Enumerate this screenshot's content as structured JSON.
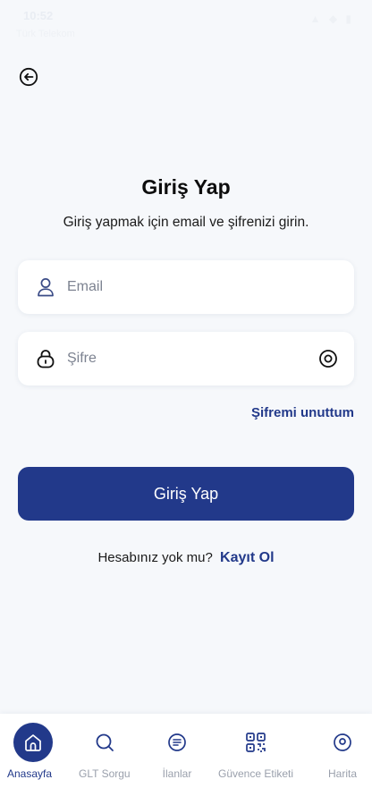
{
  "status_bar": {
    "time": "10:52",
    "carrier": "Türk Telekom",
    "indicators": "▲ ◆ ▮"
  },
  "header": {
    "back_icon": "back-arrow-circle-icon"
  },
  "page": {
    "title": "Giriş Yap",
    "subtitle": "Giriş yapmak için email ve şifrenizi girin."
  },
  "form": {
    "email": {
      "placeholder": "Email",
      "value": "",
      "icon": "user-icon"
    },
    "password": {
      "placeholder": "Şifre",
      "value": "",
      "icon": "lock-icon",
      "toggle_icon": "eye-icon"
    },
    "forgot_label": "Şifremi unuttum",
    "submit_label": "Giriş Yap"
  },
  "register": {
    "prompt": "Hesabınız yok mu?",
    "link_label": "Kayıt Ol"
  },
  "bottom_nav": {
    "active_index": 0,
    "items": [
      {
        "label": "Anasayfa",
        "icon": "home-icon"
      },
      {
        "label": "GLT Sorgu",
        "icon": "search-icon"
      },
      {
        "label": "İlanlar",
        "icon": "list-icon"
      },
      {
        "label": "Güvence Etiketi",
        "icon": "qr-code-icon"
      },
      {
        "label": "Harita",
        "icon": "map-pin-icon"
      }
    ]
  },
  "colors": {
    "primary": "#22398a",
    "background": "#f6f8fb",
    "nav_inactive": "#9aa0ac"
  }
}
